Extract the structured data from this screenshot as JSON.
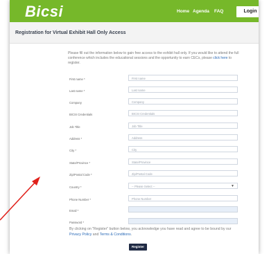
{
  "brand": {
    "logo": "Bicsi",
    "header_color": "#76b82a"
  },
  "nav": {
    "home": "Home",
    "agenda": "Agenda",
    "faq": "FAQ",
    "login": "Login"
  },
  "page": {
    "title": "Registration for Virtual Exhibit Hall Only Access"
  },
  "intro": {
    "text": "Please fill out the information below to gain free access to the exhibit hall only. If you would like to attend the full conference which includes the educational sessions and the opportunity to earn CECs, please",
    "link": "click here",
    "tail": "to register."
  },
  "form": {
    "first_name": {
      "label": "First name *",
      "placeholder": "First name"
    },
    "last_name": {
      "label": "Last name *",
      "placeholder": "Last name"
    },
    "company": {
      "label": "Company",
      "placeholder": "Company"
    },
    "bicsi_credentials": {
      "label": "BICSI Credentials",
      "placeholder": "BICSI Credentials"
    },
    "job_title": {
      "label": "Job Title",
      "placeholder": "Job Title"
    },
    "address": {
      "label": "Address *",
      "placeholder": "Address"
    },
    "city": {
      "label": "City *",
      "placeholder": "City"
    },
    "state": {
      "label": "State/Province *",
      "placeholder": "State/Province"
    },
    "zip": {
      "label": "Zip/Postal Code *",
      "placeholder": "Zip/Postal Code"
    },
    "country": {
      "label": "Country *",
      "value": "-- Please Select --"
    },
    "phone": {
      "label": "Phone Number *",
      "placeholder": "Phone Number"
    },
    "email": {
      "label": "Email *"
    },
    "password": {
      "label": "Password *"
    }
  },
  "consent": {
    "text": "By clicking on \"Register\" button below, you acknowledge you have read and agree to be bound by our",
    "privacy": "Privacy Policy",
    "and": "and",
    "terms": "Terms & Conditions",
    "end": "."
  },
  "register_button": "Register",
  "annotation": {
    "arrow_color": "#e0211b"
  }
}
